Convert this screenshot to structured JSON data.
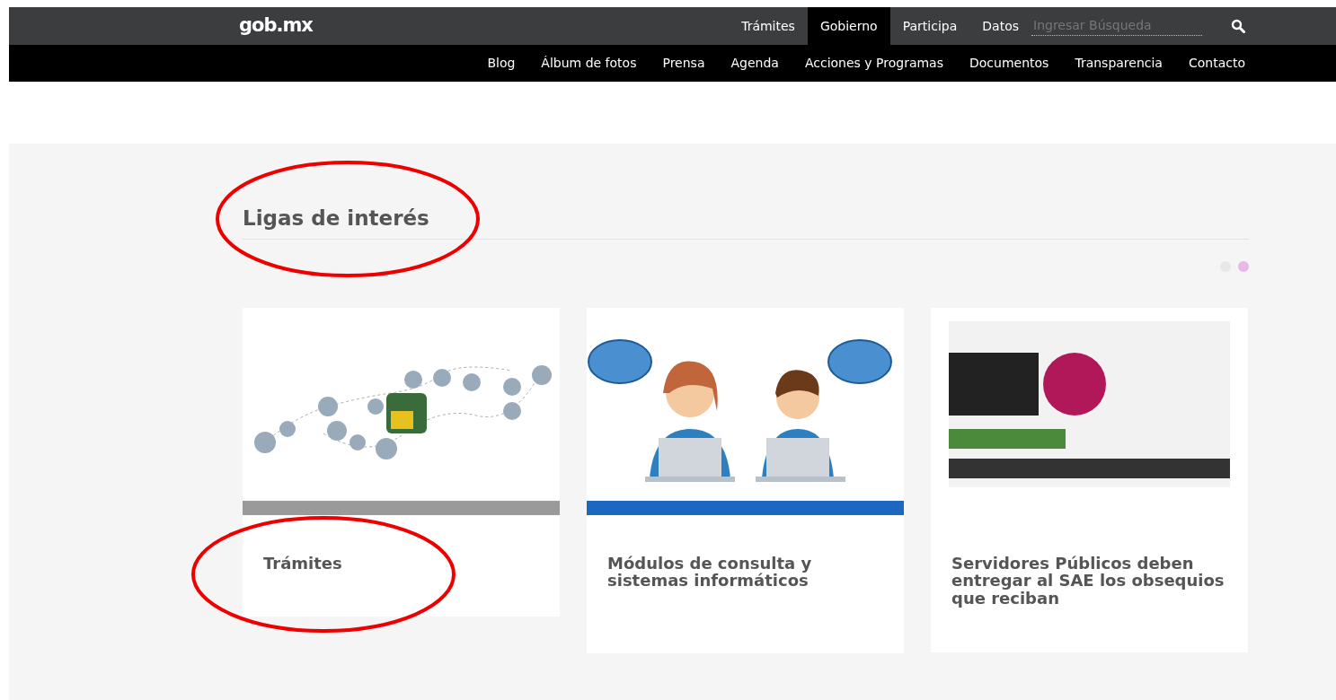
{
  "header": {
    "logo": "gob.mx",
    "nav": [
      {
        "label": "Trámites",
        "selected": false
      },
      {
        "label": "Gobierno",
        "selected": true
      },
      {
        "label": "Participa",
        "selected": false
      },
      {
        "label": "Datos",
        "selected": false
      }
    ],
    "search": {
      "placeholder": "Ingresar Búsqueda"
    }
  },
  "subnav": [
    "Blog",
    "Álbum de fotos",
    "Prensa",
    "Agenda",
    "Acciones y Programas",
    "Documentos",
    "Transparencia",
    "Contacto"
  ],
  "section": {
    "title": "Ligas de interés",
    "circled": true,
    "carousel_dots": [
      {
        "selected": false
      },
      {
        "selected": true
      }
    ],
    "cards": [
      {
        "kind": "network",
        "title": "Trámites",
        "color": "#9a9a9a",
        "circled": true
      },
      {
        "kind": "people",
        "title": "Módulos de consulta y sistemas informáticos",
        "color": "#1c68c0",
        "circled": false
      },
      {
        "kind": "poster",
        "title": "Servidores Públicos deben entregar al SAE los obsequios que reciban",
        "circled": false
      }
    ]
  }
}
